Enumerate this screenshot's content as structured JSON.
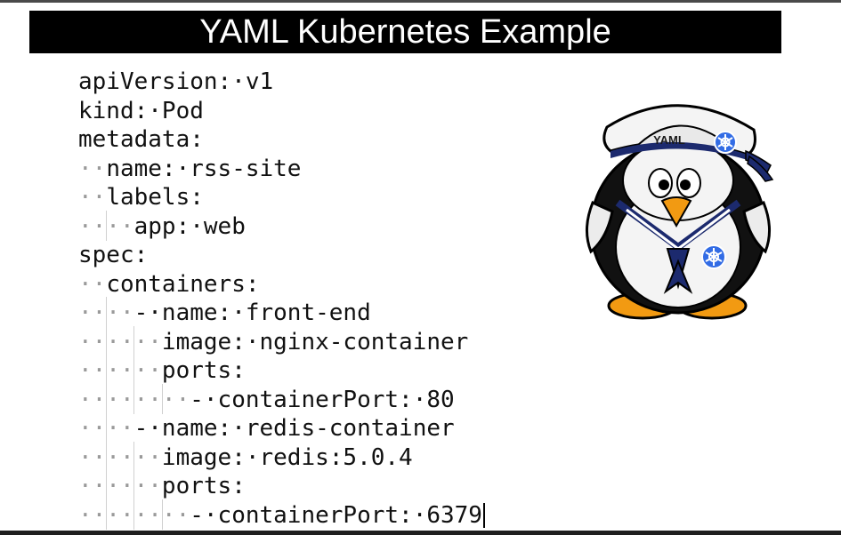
{
  "title": "YAML Kubernetes Example",
  "mascot": {
    "hat_text": "YAML",
    "icon": "kubernetes-helm-wheel-icon"
  },
  "code_lines": [
    {
      "ws": "",
      "text": "apiVersion:·v1"
    },
    {
      "ws": "",
      "text": "kind:·Pod"
    },
    {
      "ws": "",
      "text": "metadata:"
    },
    {
      "ws": "··",
      "text": "name:·rss-site"
    },
    {
      "ws": "··",
      "text": "labels:"
    },
    {
      "ws": "····",
      "text": "app:·web"
    },
    {
      "ws": "",
      "text": "spec:"
    },
    {
      "ws": "··",
      "text": "containers:"
    },
    {
      "ws": "····",
      "text": "-·name:·front-end"
    },
    {
      "ws": "······",
      "text": "image:·nginx-container"
    },
    {
      "ws": "······",
      "text": "ports:"
    },
    {
      "ws": "········",
      "text": "-·containerPort:·80"
    },
    {
      "ws": "····",
      "text": "-·name:·redis-container"
    },
    {
      "ws": "······",
      "text": "image:·redis:5.0.4"
    },
    {
      "ws": "······",
      "text": "ports:"
    },
    {
      "ws": "········",
      "text": "-·containerPort:·6379"
    }
  ]
}
